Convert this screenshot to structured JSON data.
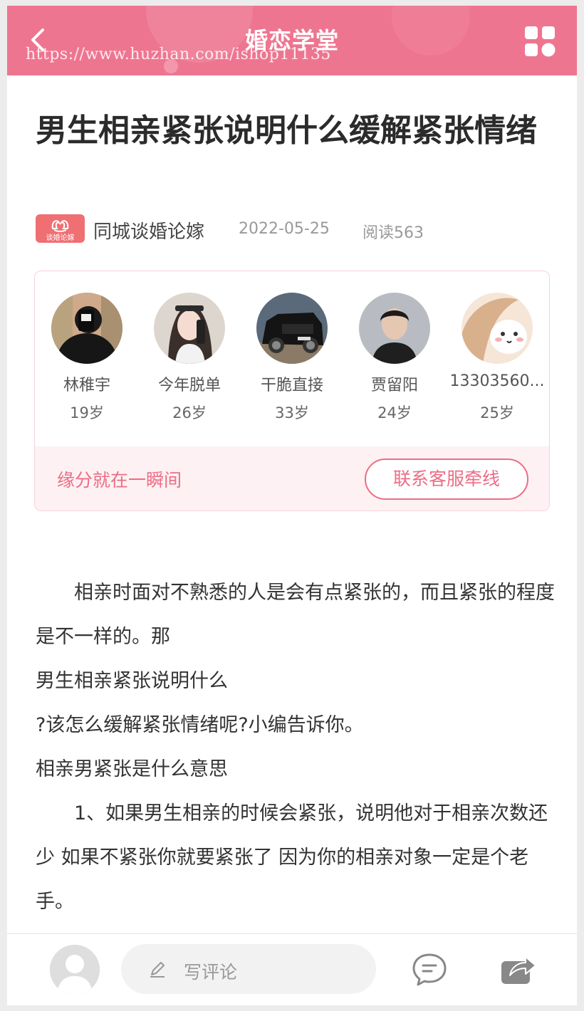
{
  "header": {
    "title": "婚恋学堂",
    "watermark": "https://www.huzhan.com/ishop11135",
    "back_icon": "chevron-left-icon",
    "menu_icon": "grid-icon",
    "color": "#ee7590"
  },
  "article": {
    "title": "男生相亲紧张说明什么缓解紧张情绪",
    "author": "同城谈婚论嫁",
    "logo_text": "谈婚论嫁",
    "date": "2022-05-25",
    "reads": "阅读563"
  },
  "recommend": {
    "users": [
      {
        "name": "林稚宇",
        "age": "19岁"
      },
      {
        "name": "今年脱单",
        "age": "26岁"
      },
      {
        "name": "干脆直接",
        "age": "33岁"
      },
      {
        "name": "贾留阳",
        "age": "24岁"
      },
      {
        "name": "13303560...",
        "age": "25岁"
      }
    ],
    "tagline": "缘分就在一瞬间",
    "contact_button": "联系客服牵线",
    "accent": "#ec6d86"
  },
  "content": {
    "paragraphs": [
      "相亲时面对不熟悉的人是会有点紧张的，而且紧张的程度是不一样的。那",
      "男生相亲紧张说明什么",
      "?该怎么缓解紧张情绪呢?小编告诉你。",
      "相亲男紧张是什么意思",
      "1、如果男生相亲的时候会紧张，说明他对于相亲次数还少 如果不紧张你就要紧张了 因为你的相亲对象一定是个老手。"
    ]
  },
  "bottom": {
    "comment_placeholder": "写评论",
    "pen_icon": "pen-icon",
    "message_icon": "message-icon",
    "share_icon": "share-icon",
    "avatar_icon": "user-avatar-icon"
  }
}
